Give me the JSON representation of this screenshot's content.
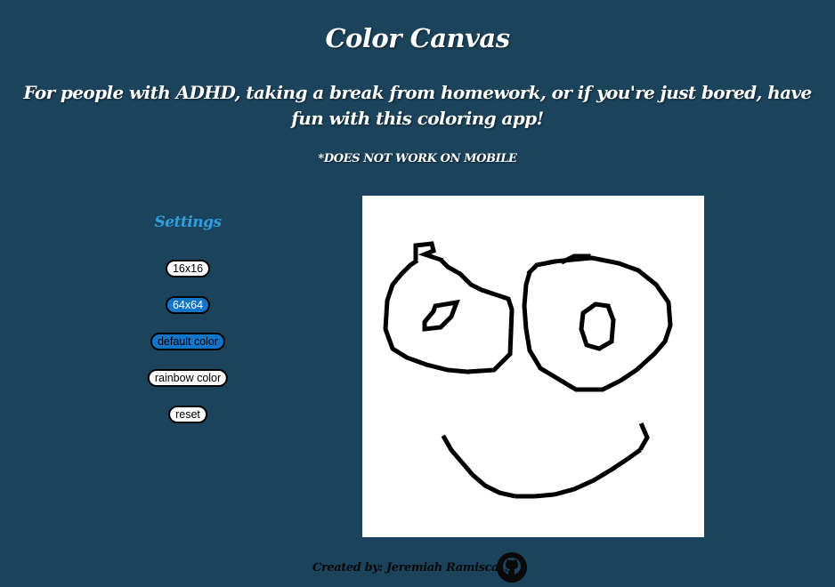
{
  "header": {
    "title": "Color Canvas",
    "subtitle": "For people with ADHD, taking a break from homework, or if you're just bored, have fun with this coloring app!",
    "warning": "*DOES NOT WORK ON MOBILE"
  },
  "settings": {
    "heading": "Settings",
    "buttons": {
      "grid_16": "16x16",
      "grid_64": "64x64",
      "default_color": "default color",
      "rainbow_color": "rainbow color",
      "reset": "reset"
    },
    "selected_grid": "64x64",
    "selected_mode": "default color"
  },
  "canvas": {
    "grid_size": 64,
    "background": "#ffffff",
    "ink": "#000000"
  },
  "footer": {
    "credit": "Created by: Jeremiah Ramiscal",
    "icon": "github-icon"
  },
  "colors": {
    "page_background": "#1b445c",
    "accent": "#2f9ee0",
    "active_button": "#1275c8"
  }
}
